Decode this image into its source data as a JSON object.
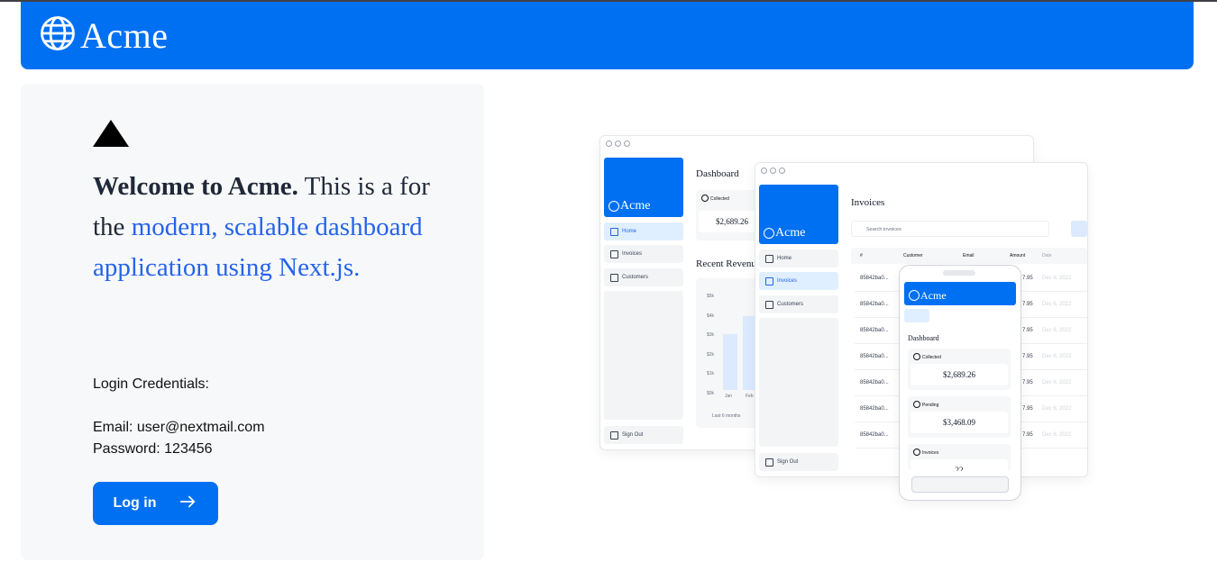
{
  "header": {
    "logo_text": "Acme",
    "logo_icon": "globe-icon",
    "color": "#0070f3"
  },
  "hero": {
    "welcome_bold": "Welcome to Acme.",
    "welcome_plain": " This is a for the ",
    "welcome_link": "modern, scalable dashboard application using Next.js.",
    "credentials_title": "Login Credentials:",
    "email_line": "Email: user@nextmail.com",
    "password_line": "Password: 123456",
    "login_label": "Log in",
    "login_icon": "arrow-right-icon"
  },
  "mock_desktop": {
    "logo": "Acme",
    "title": "Dashboard",
    "nav": [
      "Home",
      "Invoices",
      "Customers"
    ],
    "signout": "Sign Out",
    "collected_label": "Collected",
    "collected_value": "$2,689.26",
    "revenue_title": "Recent Revenue",
    "y_ticks": [
      "$5k",
      "$4k",
      "$3k",
      "$2k",
      "$1k",
      "$0k"
    ],
    "x_ticks": [
      "Jan",
      "Feb"
    ],
    "footer": "Last 6 months"
  },
  "mock_tablet": {
    "logo": "Acme",
    "title": "Invoices",
    "search_placeholder": "Search invoices",
    "nav": [
      "Home",
      "Invoices",
      "Customers"
    ],
    "signout": "Sign Out",
    "columns": [
      "#",
      "Customer",
      "Email",
      "Amount",
      "Date"
    ],
    "rows": [
      {
        "id": "85842ba0...",
        "amount": "7.95",
        "date": "Dec 6, 2022"
      },
      {
        "id": "85842ba0...",
        "amount": "7.95",
        "date": "Dec 6, 2022"
      },
      {
        "id": "85842ba0...",
        "amount": "7.95",
        "date": "Dec 6, 2022"
      },
      {
        "id": "85842ba0...",
        "amount": "7.95",
        "date": "Dec 6, 2022"
      },
      {
        "id": "85842ba0...",
        "amount": "7.95",
        "date": "Dec 6, 2022"
      },
      {
        "id": "85842ba0...",
        "amount": "7.95",
        "date": "Dec 6, 2022"
      },
      {
        "id": "85842ba0...",
        "amount": "7.95",
        "date": "Dec 6, 2022"
      }
    ]
  },
  "mock_phone": {
    "logo": "Acme",
    "title": "Dashboard",
    "collected_label": "Collected",
    "collected_value": "$2,689.26",
    "pending_label": "Pending",
    "pending_value": "$3,468.09",
    "invoices_label": "Invoices",
    "invoices_value": "22"
  }
}
